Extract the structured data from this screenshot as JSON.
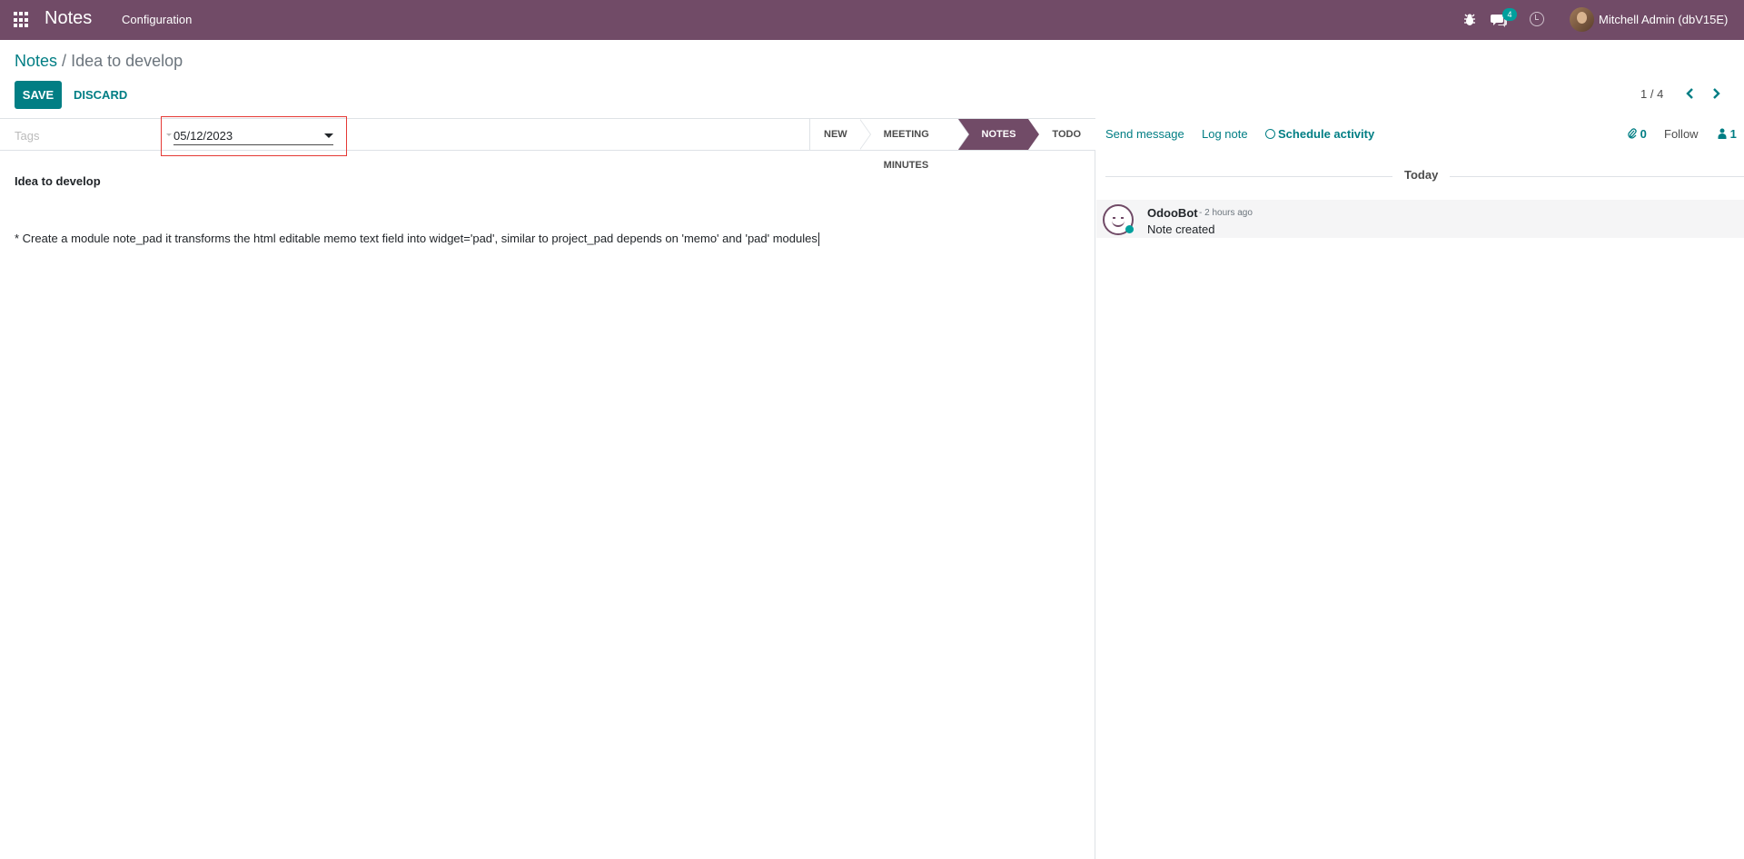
{
  "navbar": {
    "app_name": "Notes",
    "menu_configuration": "Configuration",
    "chat_badge": "4",
    "user_name": "Mitchell Admin (dbV15E)",
    "icons": [
      "apps-grid-icon",
      "bug-icon",
      "chat-icon",
      "clock-icon"
    ],
    "color": "#714b67"
  },
  "breadcrumb": {
    "parent": "Notes",
    "separator": "/",
    "current": "Idea to develop"
  },
  "actions": {
    "save_label": "SAVE",
    "discard_label": "DISCARD"
  },
  "pager": {
    "value": "1 / 4"
  },
  "form": {
    "tags_placeholder": "Tags",
    "date_value": "05/12/2023",
    "stages": [
      {
        "label": "NEW",
        "active": false
      },
      {
        "label": "MEETING MINUTES",
        "active": false
      },
      {
        "label": "NOTES",
        "active": true
      },
      {
        "label": "TODO",
        "active": false
      }
    ],
    "note_title": "Idea to develop",
    "note_body": "* Create a module note_pad it transforms the html editable memo text field into widget='pad', similar to project_pad depends on 'memo' and 'pad' modules"
  },
  "chatter": {
    "send_message": "Send message",
    "log_note": "Log note",
    "schedule_activity": "Schedule activity",
    "attachments_count": "0",
    "follow": "Follow",
    "followers_count": "1",
    "date_separator": "Today",
    "messages": [
      {
        "author": "OdooBot",
        "time": "- 2 hours ago",
        "body": "Note created"
      }
    ]
  },
  "colors": {
    "accent": "#017e84",
    "brand": "#714b67",
    "highlight_box": "#e53935"
  }
}
